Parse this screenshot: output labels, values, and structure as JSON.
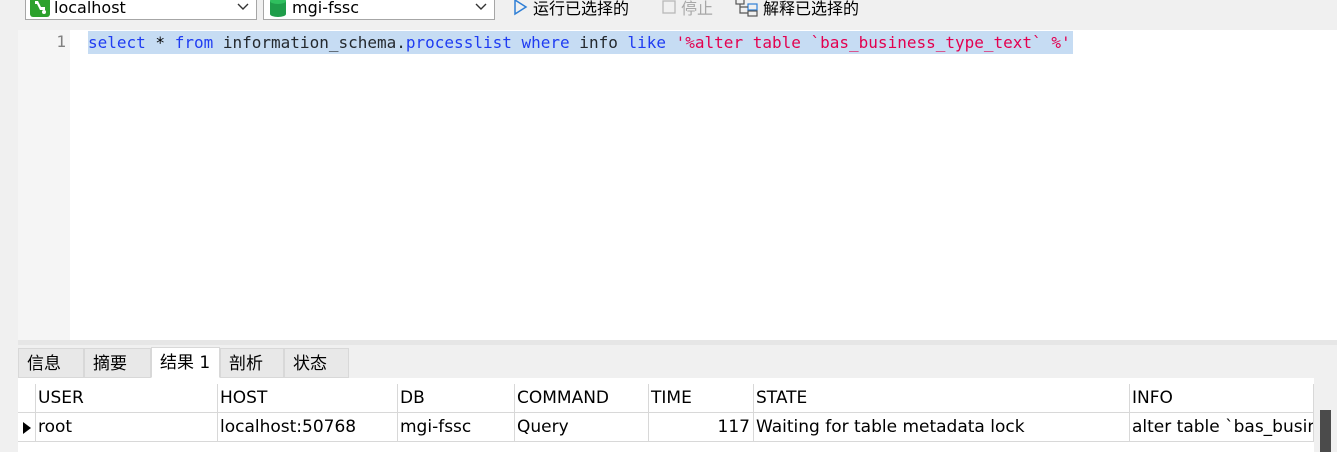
{
  "toolbar": {
    "connection": {
      "label": "localhost",
      "icon": "connection-icon"
    },
    "database": {
      "label": "mgi-fssc",
      "icon": "database-icon"
    },
    "run_selected": {
      "label": "运行已选择的",
      "icon": "play-icon"
    },
    "stop": {
      "label": "停止",
      "icon": "stop-icon",
      "disabled": true
    },
    "explain_selected": {
      "label": "解释已选择的",
      "icon": "explain-icon"
    }
  },
  "editor": {
    "line_number": "1",
    "tokens": {
      "t1": "select",
      "t2": " * ",
      "t3": "from",
      "t4": " information_schema.",
      "t5": "processlist",
      "t6": " ",
      "t7": "where",
      "t8": " info ",
      "t9": "like",
      "t10": " ",
      "t11": "'%alter table `bas_business_type_text` %'"
    }
  },
  "result_tabs": [
    {
      "label": "信息"
    },
    {
      "label": "摘要"
    },
    {
      "label": "结果 1",
      "active": true
    },
    {
      "label": "剖析"
    },
    {
      "label": "状态"
    }
  ],
  "grid": {
    "columns": [
      "USER",
      "HOST",
      "DB",
      "COMMAND",
      "TIME",
      "STATE",
      "INFO"
    ],
    "rows": [
      [
        "root",
        "localhost:50768",
        "mgi-fssc",
        "Query",
        "117",
        "Waiting for table metadata lock",
        "alter table `bas_business_type_text`"
      ]
    ]
  },
  "colors": {
    "keyword": "#1f3cf2",
    "string": "#e3004f",
    "selection": "#c6dcf3",
    "connection_icon": "#2da12d",
    "database_icon": "#1f9d4a"
  }
}
